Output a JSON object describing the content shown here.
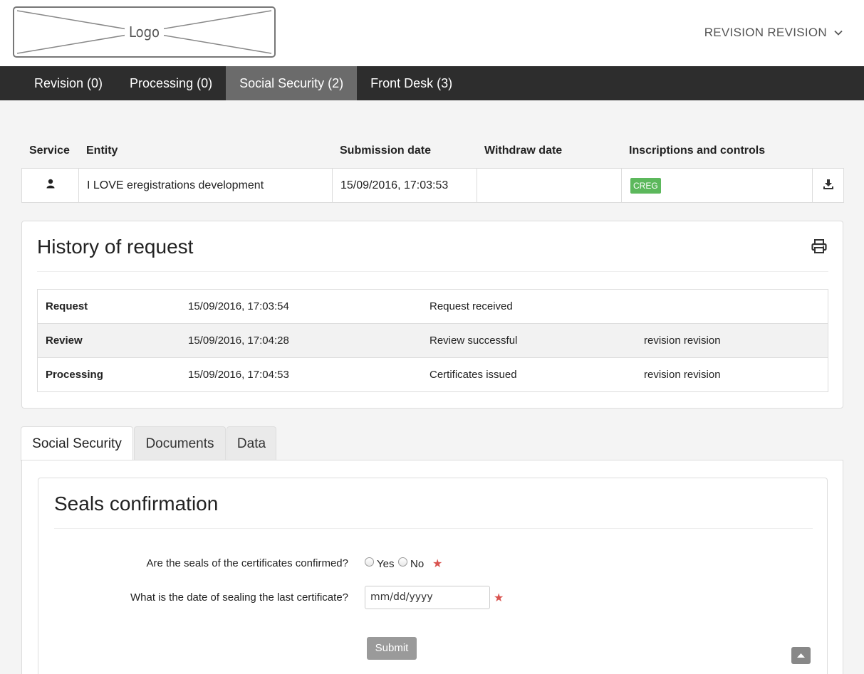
{
  "header": {
    "logo_text": "Logo",
    "user_name": "REVISION REVISION"
  },
  "nav": {
    "tabs": [
      {
        "label": "Revision (0)",
        "active": false
      },
      {
        "label": "Processing (0)",
        "active": false
      },
      {
        "label": "Social Security (2)",
        "active": true
      },
      {
        "label": "Front Desk (3)",
        "active": false
      }
    ]
  },
  "requests_table": {
    "headers": [
      "Service",
      "Entity",
      "Submission date",
      "Withdraw date",
      "Inscriptions and controls"
    ],
    "row": {
      "service_icon": "user-icon",
      "entity": "I LOVE eregistrations development",
      "submission_date": "15/09/2016, 17:03:53",
      "withdraw_date": "",
      "badge": "CREG",
      "badge_color": "#5cb85c",
      "action_icon": "download-icon"
    }
  },
  "history": {
    "title": "History of request",
    "print_icon": "print-icon",
    "rows": [
      {
        "step": "Request",
        "date": "15/09/2016, 17:03:54",
        "status": "Request received",
        "user": ""
      },
      {
        "step": "Review",
        "date": "15/09/2016, 17:04:28",
        "status": "Review successful",
        "user": "revision revision"
      },
      {
        "step": "Processing",
        "date": "15/09/2016, 17:04:53",
        "status": "Certificates issued",
        "user": "revision revision"
      }
    ]
  },
  "detail_tabs": [
    {
      "label": "Social Security",
      "active": true
    },
    {
      "label": "Documents",
      "active": false
    },
    {
      "label": "Data",
      "active": false
    }
  ],
  "seals_form": {
    "title": "Seals confirmation",
    "question_1": "Are the seals of the certificates confirmed?",
    "option_yes": "Yes",
    "option_no": "No",
    "question_2": "What is the date of sealing the last certificate?",
    "date_placeholder": "mm/dd/yyyy",
    "required_mark": "★",
    "submit_label": "Submit"
  },
  "colors": {
    "nav_bg": "#2d2d2d",
    "nav_active": "#6b6b6b",
    "required": "#d9534f"
  }
}
